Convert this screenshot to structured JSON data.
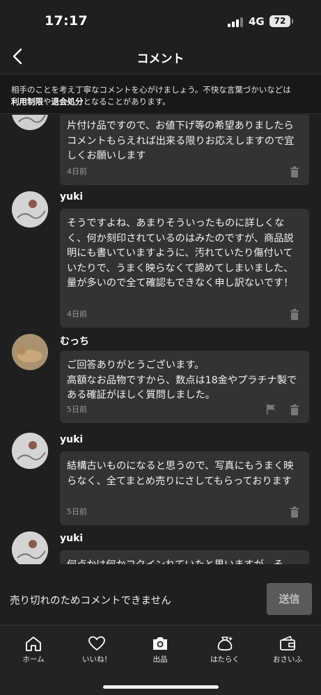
{
  "status": {
    "time": "17:17",
    "network": "4G",
    "battery": "72"
  },
  "nav": {
    "title": "コメント"
  },
  "notice": {
    "line1": "相手のことを考え丁寧なコメントを心がけましょう。不快な言葉づかいなどは",
    "link1": "利用制限",
    "mid": "や",
    "link2": "退会処分",
    "tail": "となることがあります。"
  },
  "comments": [
    {
      "user": "",
      "text": "片付け品ですので、お値下げ等の希望ありましたらコメントもらえれば出来る限りお応えしますので宜しくお願いします",
      "time": "4日前",
      "avatar": "yuki-photo"
    },
    {
      "user": "yuki",
      "text": "そうですよね、あまりそういったものに詳しくなく、何か刻印されているのはみたのですが、商品説明にも書いていますように、汚れていたり傷付いていたりで、うまく映らなくて諦めてしまいました、量が多いので全て確認もできなく申し訳ないです！",
      "time": "4日前",
      "avatar": "yuki-photo"
    },
    {
      "user": "むっち",
      "text": "ご回答ありがとうございます。\n高額なお品物ですから、数点は18金やプラチナ製である確証がほしく質問しました。",
      "time": "5日前",
      "avatar": "mucchi-photo"
    },
    {
      "user": "yuki",
      "text": "結構古いものになると思うので、写真にもうまく映らなく、全てまとめ売りにさしてもらっております",
      "time": "5日前",
      "avatar": "yuki-photo"
    },
    {
      "user": "yuki",
      "text": "何点かは何かコクインれていたと思いますが、そ",
      "time": "",
      "avatar": "yuki-photo"
    }
  ],
  "footer": {
    "closed_message": "売り切れのためコメントできません",
    "send_label": "送信"
  },
  "tabs": [
    {
      "label": "ホーム",
      "icon": "home-icon"
    },
    {
      "label": "いいね！",
      "icon": "heart-icon"
    },
    {
      "label": "出品",
      "icon": "camera-icon"
    },
    {
      "label": "はたらく",
      "icon": "bag-icon"
    },
    {
      "label": "おさいふ",
      "icon": "wallet-icon"
    }
  ],
  "colors": {
    "background": "#1f1f1f",
    "bubble": "#333333",
    "send_disabled": "#5a5a5a"
  }
}
